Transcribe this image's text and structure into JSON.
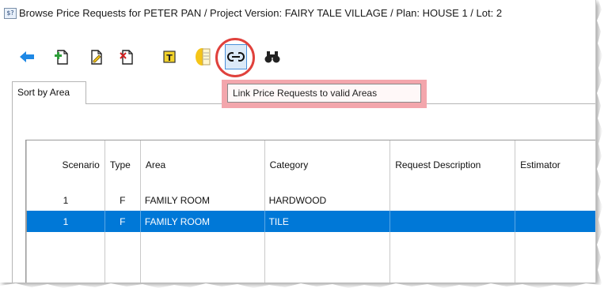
{
  "window": {
    "title": "Browse Price Requests for PETER PAN  /  Project Version:  FAIRY TALE VILLAGE  /  Plan: HOUSE 1  /  Lot: 2",
    "app_icon": "app-window-icon"
  },
  "toolbar": {
    "buttons": [
      {
        "name": "back-arrow-icon"
      },
      {
        "name": "add-document-icon"
      },
      {
        "name": "edit-document-icon"
      },
      {
        "name": "delete-document-icon"
      },
      {
        "name": "text-tool-icon"
      },
      {
        "name": "notes-icon"
      },
      {
        "name": "link-icon"
      },
      {
        "name": "binoculars-icon"
      }
    ],
    "tooltip": "Link Price Requests to valid Areas",
    "highlight_color": "#e0413c"
  },
  "tabs": [
    {
      "label": "Sort by Area"
    }
  ],
  "grid": {
    "columns": [
      "Scenario",
      "Type",
      "Area",
      "Category",
      "Request Description",
      "Estimator"
    ],
    "rows": [
      {
        "scenario": "1",
        "type": "F",
        "area": "FAMILY ROOM",
        "category": "HARDWOOD",
        "description": "",
        "estimator": ""
      },
      {
        "scenario": "1",
        "type": "F",
        "area": "FAMILY ROOM",
        "category": "TILE",
        "description": "",
        "estimator": ""
      }
    ],
    "selected_row": 1,
    "selection_color": "#0078d7"
  }
}
